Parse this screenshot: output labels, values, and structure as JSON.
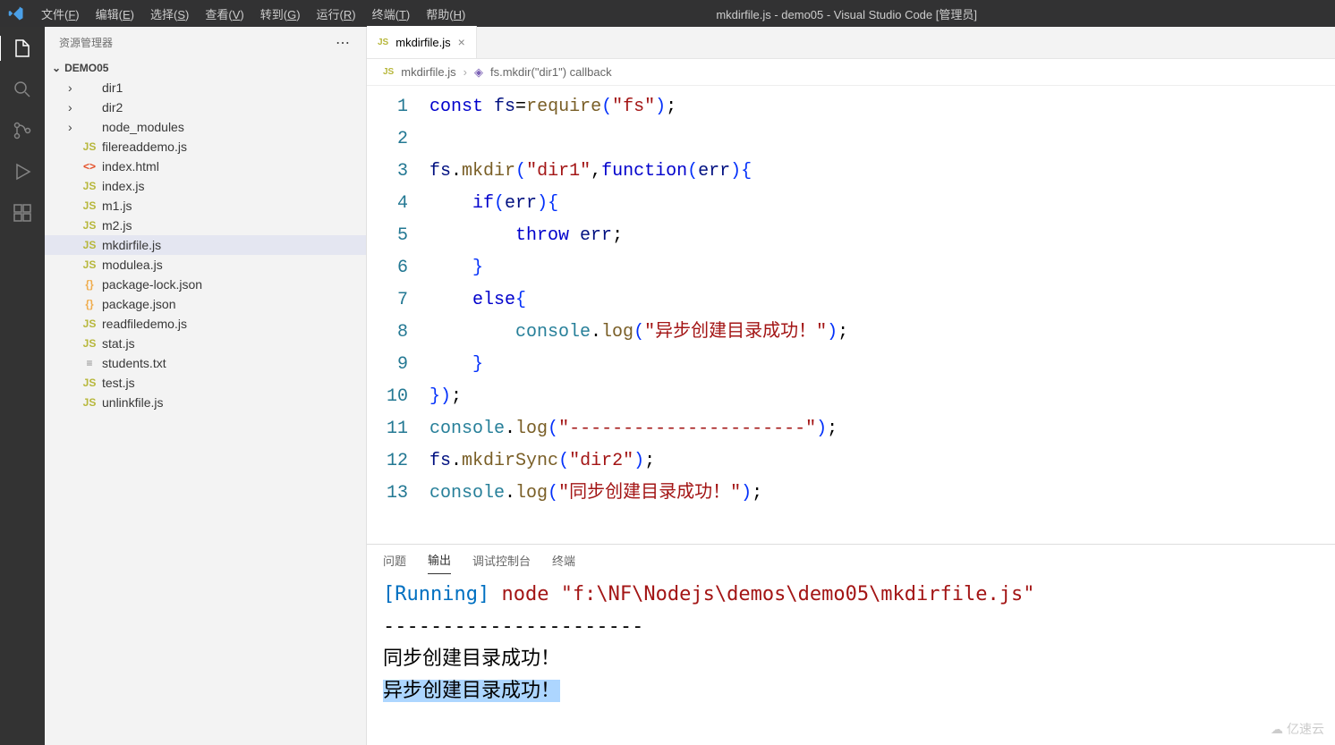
{
  "title": "mkdirfile.js - demo05 - Visual Studio Code [管理员]",
  "menus": [
    "文件(F)",
    "编辑(E)",
    "选择(S)",
    "查看(V)",
    "转到(G)",
    "运行(R)",
    "终端(T)",
    "帮助(H)"
  ],
  "sidebar": {
    "header": "资源管理器",
    "project": "DEMO05",
    "items": [
      {
        "type": "folder",
        "label": "dir1"
      },
      {
        "type": "folder",
        "label": "dir2"
      },
      {
        "type": "folder",
        "label": "node_modules"
      },
      {
        "type": "js",
        "label": "filereaddemo.js"
      },
      {
        "type": "html",
        "label": "index.html"
      },
      {
        "type": "js",
        "label": "index.js"
      },
      {
        "type": "js",
        "label": "m1.js"
      },
      {
        "type": "js",
        "label": "m2.js"
      },
      {
        "type": "js",
        "label": "mkdirfile.js",
        "selected": true
      },
      {
        "type": "js",
        "label": "modulea.js"
      },
      {
        "type": "json",
        "label": "package-lock.json"
      },
      {
        "type": "json",
        "label": "package.json"
      },
      {
        "type": "js",
        "label": "readfiledemo.js"
      },
      {
        "type": "js",
        "label": "stat.js"
      },
      {
        "type": "txt",
        "label": "students.txt"
      },
      {
        "type": "js",
        "label": "test.js"
      },
      {
        "type": "js",
        "label": "unlinkfile.js"
      }
    ]
  },
  "tab": {
    "label": "mkdirfile.js"
  },
  "breadcrumb": {
    "file": "mkdirfile.js",
    "symbol": "fs.mkdir(\"dir1\") callback"
  },
  "code": [
    {
      "n": 1,
      "html": "<span class='tok-kw'>const</span> <span class='tok-var'>fs</span>=<span class='tok-fn'>require</span><span class='tok-par'>(</span><span class='tok-str'>\"fs\"</span><span class='tok-par'>)</span>;"
    },
    {
      "n": 2,
      "html": ""
    },
    {
      "n": 3,
      "html": "<span class='tok-var'>fs</span>.<span class='tok-fn'>mkdir</span><span class='tok-par'>(</span><span class='tok-str'>\"dir1\"</span>,<span class='tok-kw'>function</span><span class='tok-par'>(</span><span class='tok-var'>err</span><span class='tok-par'>)</span><span class='tok-par'>{</span>"
    },
    {
      "n": 4,
      "html": "    <span class='tok-kw'>if</span><span class='tok-par'>(</span><span class='tok-var'>err</span><span class='tok-par'>)</span><span class='tok-par'>{</span>"
    },
    {
      "n": 5,
      "html": "        <span class='tok-kw'>throw</span> <span class='tok-var'>err</span>;"
    },
    {
      "n": 6,
      "html": "    <span class='tok-par'>}</span>"
    },
    {
      "n": 7,
      "html": "    <span class='tok-kw'>else</span><span class='tok-par'>{</span>"
    },
    {
      "n": 8,
      "html": "        <span class='tok-cons'>console</span>.<span class='tok-fn'>log</span><span class='tok-par'>(</span><span class='tok-str'>\"异步创建目录成功！\"</span><span class='tok-par'>)</span>;"
    },
    {
      "n": 9,
      "html": "    <span class='tok-par'>}</span>"
    },
    {
      "n": 10,
      "html": "<span class='tok-par'>}</span><span class='tok-par'>)</span>;"
    },
    {
      "n": 11,
      "html": "<span class='tok-cons'>console</span>.<span class='tok-fn'>log</span><span class='tok-par'>(</span><span class='tok-str'>\"----------------------\"</span><span class='tok-par'>)</span>;"
    },
    {
      "n": 12,
      "html": "<span class='tok-var'>fs</span>.<span class='tok-fn'>mkdirSync</span><span class='tok-par'>(</span><span class='tok-str'>\"dir2\"</span><span class='tok-par'>)</span>;"
    },
    {
      "n": 13,
      "html": "<span class='tok-cons'>console</span>.<span class='tok-fn'>log</span><span class='tok-par'>(</span><span class='tok-str'>\"同步创建目录成功！\"</span><span class='tok-par'>)</span>;"
    }
  ],
  "panel": {
    "tabs": [
      "问题",
      "输出",
      "调试控制台",
      "终端"
    ],
    "active": 1,
    "output": {
      "running": "[Running]",
      "cmd": " node \"f:\\NF\\Nodejs\\demos\\demo05\\mkdirfile.js\"",
      "dashes": "----------------------",
      "line1": "同步创建目录成功！",
      "line2": "异步创建目录成功！"
    }
  },
  "watermark": "亿速云"
}
